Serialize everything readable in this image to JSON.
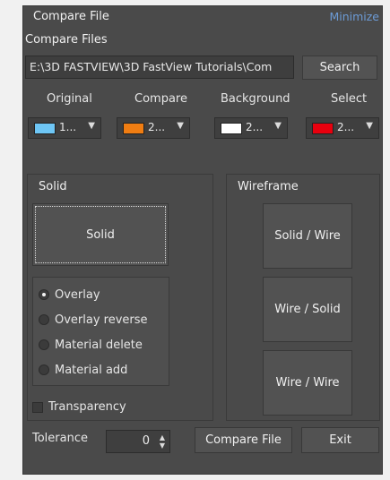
{
  "window": {
    "title": "Compare File",
    "minimize_label": "Minimize"
  },
  "compare_files": {
    "label": "Compare Files",
    "path_value": "E:\\3D FASTVIEW\\3D FastView Tutorials\\Com",
    "search_label": "Search"
  },
  "colors": [
    {
      "label": "Original",
      "value": "1...",
      "swatch": "#6ec6f5"
    },
    {
      "label": "Compare",
      "value": "2...",
      "swatch": "#f07d12"
    },
    {
      "label": "Background",
      "value": "2...",
      "swatch": "#ffffff"
    },
    {
      "label": "Select",
      "value": "2...",
      "swatch": "#e8000e"
    }
  ],
  "solid_group": {
    "title": "Solid",
    "solid_button": "Solid",
    "radios": [
      {
        "label": "Overlay",
        "checked": true
      },
      {
        "label": "Overlay reverse",
        "checked": false
      },
      {
        "label": "Material delete",
        "checked": false
      },
      {
        "label": "Material add",
        "checked": false
      }
    ],
    "transparency_label": "Transparency"
  },
  "wireframe_group": {
    "title": "Wireframe",
    "buttons": [
      "Solid / Wire",
      "Wire / Solid",
      "Wire / Wire"
    ]
  },
  "bottom": {
    "tolerance_label": "Tolerance",
    "tolerance_value": "0",
    "compare_button": "Compare File",
    "exit_button": "Exit"
  }
}
